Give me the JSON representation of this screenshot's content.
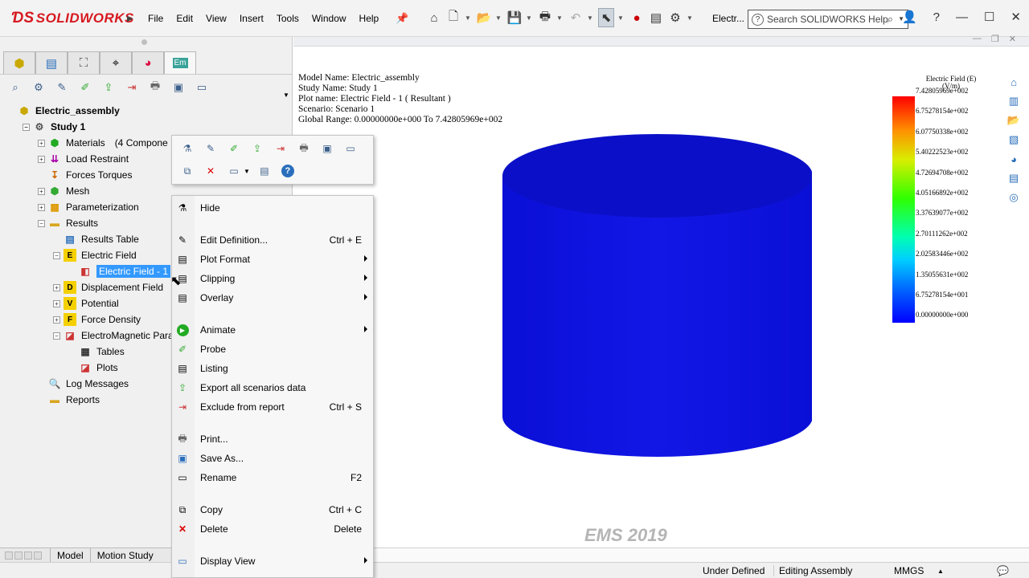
{
  "app": {
    "logo": "SOLIDWORKS",
    "doc_title": "Electr..."
  },
  "menu": [
    "File",
    "Edit",
    "View",
    "Insert",
    "Tools",
    "Window",
    "Help"
  ],
  "help_search": {
    "placeholder": "Search SOLIDWORKS Help"
  },
  "feature_manager": {
    "tabs": [
      "feature-manager",
      "property-manager",
      "configuration-manager",
      "dimxpert-manager",
      "display-manager",
      "ems-manager"
    ],
    "active_tab": "Em"
  },
  "tree": {
    "root": "Electric_assembly",
    "study": "Study 1",
    "materials": "Materials",
    "materials_count": "(4 Compone",
    "load_restraint": "Load Restraint",
    "forces_torques": "Forces Torques",
    "mesh": "Mesh",
    "parameterization": "Parameterization",
    "results": "Results",
    "results_table": "Results Table",
    "electric_field": "Electric Field",
    "electric_field_1": "Electric Field - 1",
    "displacement_field": "Displacement Field",
    "potential": "Potential",
    "force_density": "Force Density",
    "em_params": "ElectroMagnetic Para",
    "tables": "Tables",
    "plots": "Plots",
    "log_messages": "Log Messages",
    "reports": "Reports"
  },
  "bottom_tabs": [
    "Model",
    "Motion Study"
  ],
  "plot_info": {
    "model_name": "Model Name: Electric_assembly",
    "study_name": "Study Name: Study 1",
    "plot_name": "Plot name: Electric Field - 1 ( Resultant )",
    "scenario": "Scenario: Scenario 1",
    "global_range": "Global Range: 0.00000000e+000 To 7.42805969e+002"
  },
  "legend": {
    "title": "Electric Field (E)",
    "unit": "(V/m)",
    "labels": [
      "7.42805969e+002",
      "6.75278154e+002",
      "6.07750338e+002",
      "5.40222523e+002",
      "4.72694708e+002",
      "4.05166892e+002",
      "3.37639077e+002",
      "2.70111262e+002",
      "2.02583446e+002",
      "1.35055631e+002",
      "6.75278154e+001",
      "0.00000000e+000"
    ],
    "max_color": "#ff0000",
    "min_color": "#0000ff"
  },
  "model_color": "#0b10d9",
  "watermark": "EMS 2019",
  "context_menu": {
    "hide": "Hide",
    "edit_definition": "Edit Definition...",
    "edit_definition_sc": "Ctrl + E",
    "plot_format": "Plot Format",
    "clipping": "Clipping",
    "overlay": "Overlay",
    "animate": "Animate",
    "probe": "Probe",
    "listing": "Listing",
    "export_all": "Export all scenarios data",
    "exclude": "Exclude from report",
    "exclude_sc": "Ctrl + S",
    "print": "Print...",
    "save_as": "Save As...",
    "rename": "Rename",
    "rename_sc": "F2",
    "copy": "Copy",
    "copy_sc": "Ctrl + C",
    "delete": "Delete",
    "delete_sc": "Delete",
    "display_view": "Display View"
  },
  "status": {
    "under_defined": "Under Defined",
    "editing": "Editing Assembly",
    "units": "MMGS"
  }
}
